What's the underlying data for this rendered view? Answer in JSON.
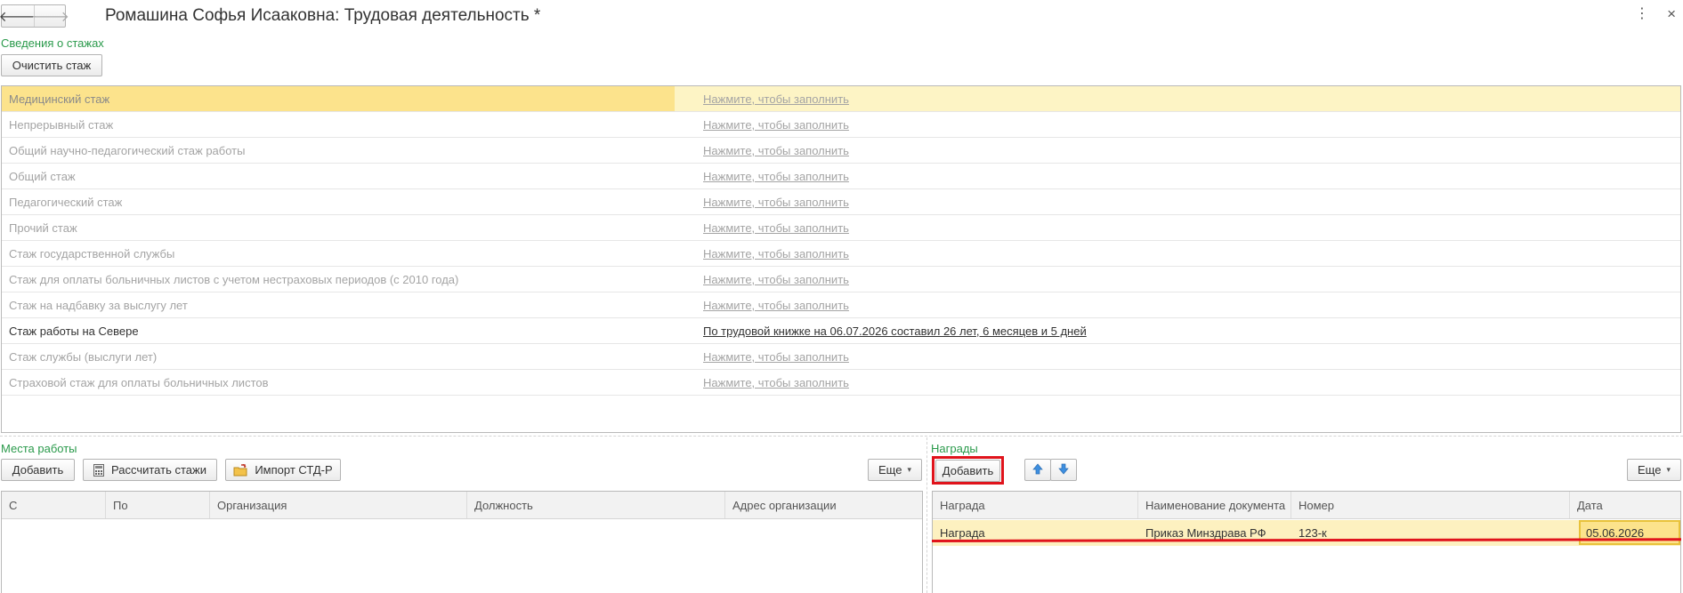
{
  "window": {
    "title": "Ромашина Софья Исааковна: Трудовая деятельность *",
    "back_glyph": "🡐",
    "forward_glyph": "🡒",
    "more_glyph": "⋮",
    "close_glyph": "×"
  },
  "stazh": {
    "group_title": "Сведения о стажах",
    "clear_button": "Очистить стаж",
    "rows": [
      {
        "name": "Медицинский стаж",
        "value": "Нажмите, чтобы заполнить"
      },
      {
        "name": "Непрерывный стаж",
        "value": "Нажмите, чтобы заполнить"
      },
      {
        "name": "Общий научно-педагогический стаж работы",
        "value": "Нажмите, чтобы заполнить"
      },
      {
        "name": "Общий стаж",
        "value": "Нажмите, чтобы заполнить"
      },
      {
        "name": "Педагогический стаж",
        "value": "Нажмите, чтобы заполнить"
      },
      {
        "name": "Прочий стаж",
        "value": "Нажмите, чтобы заполнить"
      },
      {
        "name": "Стаж государственной службы",
        "value": "Нажмите, чтобы заполнить"
      },
      {
        "name": "Стаж для оплаты больничных листов с учетом нестраховых периодов (с 2010 года)",
        "value": "Нажмите, чтобы заполнить"
      },
      {
        "name": "Стаж на надбавку за выслугу лет",
        "value": "Нажмите, чтобы заполнить"
      },
      {
        "name": "Стаж работы на Севере",
        "value": "По трудовой книжке на 06.07.2026 составил 26 лет, 6 месяцев и 5 дней"
      },
      {
        "name": "Стаж службы (выслуги лет)",
        "value": "Нажмите, чтобы заполнить"
      },
      {
        "name": "Страховой стаж для оплаты больничных листов",
        "value": "Нажмите, чтобы заполнить"
      }
    ]
  },
  "workplaces": {
    "group_title": "Места работы",
    "add_button": "Добавить",
    "calc_button": "Рассчитать стажи",
    "import_button": "Импорт СТД-Р",
    "more_button": "Еще",
    "columns": [
      "С",
      "По",
      "Организация",
      "Должность",
      "Адрес организации"
    ]
  },
  "awards": {
    "group_title": "Награды",
    "add_button": "Добавить",
    "more_button": "Еще",
    "columns": [
      "Награда",
      "Наименование документа",
      "Номер",
      "Дата"
    ],
    "rows": [
      {
        "award": "Награда",
        "doc": "Приказ Минздрава РФ",
        "number": "123-к",
        "date": "05.06.2026"
      }
    ]
  }
}
